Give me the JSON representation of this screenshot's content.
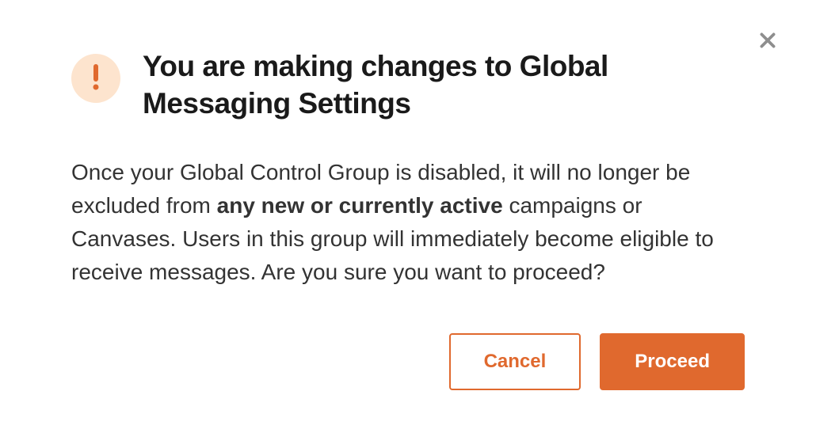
{
  "modal": {
    "title": "You are making changes to Global Messaging Settings",
    "body_before": "Once your Global Control Group is disabled, it will no longer be excluded from ",
    "body_bold": "any new or currently active",
    "body_after": " campaigns or Canvases. Users in this group will immediately become eligible to receive messages. Are you sure you want to proceed?",
    "cancel_label": "Cancel",
    "proceed_label": "Proceed"
  },
  "colors": {
    "accent": "#e0692e",
    "icon_bg": "#fde4ce"
  }
}
